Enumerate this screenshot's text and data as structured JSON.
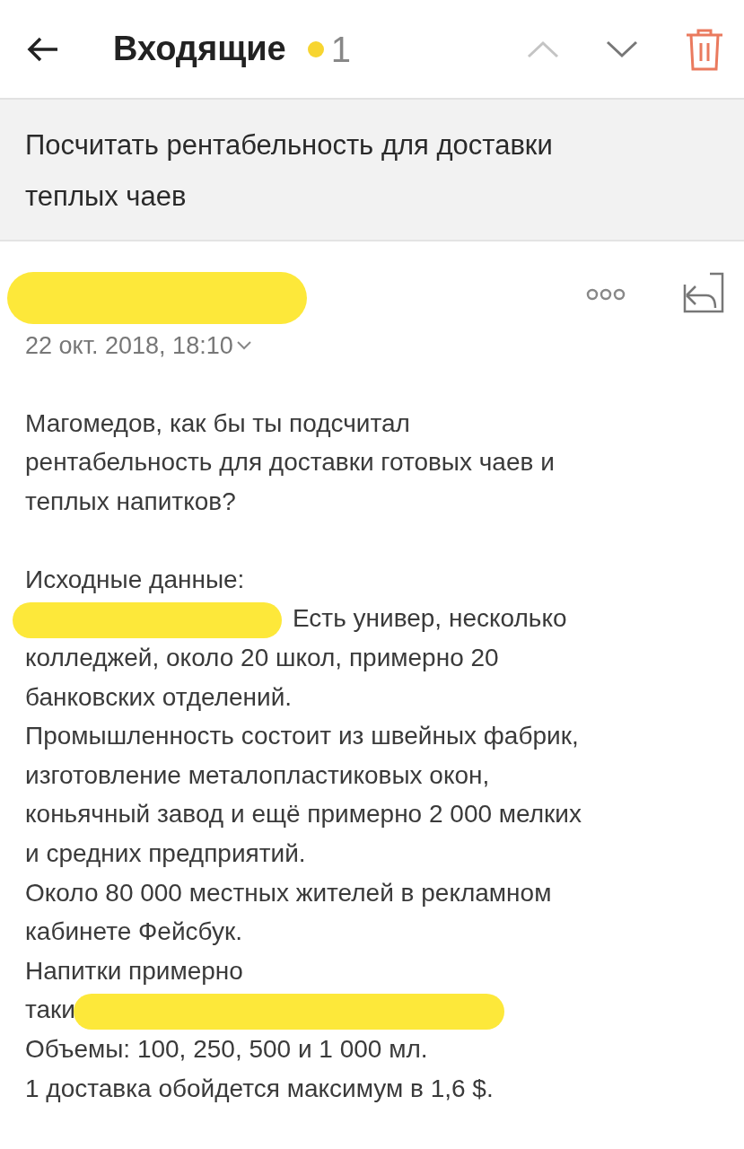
{
  "header": {
    "title": "Входящие",
    "unread_count": "1"
  },
  "subject": "Посчитать рентабельность для доставки теплых чаев",
  "message": {
    "sender_redacted": true,
    "date": "22 окт. 2018, 18:10",
    "body": [
      {
        "kind": "text",
        "text": "Магомедов, как бы ты подсчитал"
      },
      {
        "kind": "text",
        "text": "рентабельность для доставки готовых чаев и"
      },
      {
        "kind": "text",
        "text": "теплых напитков?"
      },
      {
        "kind": "blank"
      },
      {
        "kind": "text",
        "text": "Исходные данные:"
      },
      {
        "kind": "redacted",
        "after": "Есть универ, несколько"
      },
      {
        "kind": "text",
        "text": "колледжей, около 20 школ, примерно 20"
      },
      {
        "kind": "text",
        "text": "банковских отделений."
      },
      {
        "kind": "text",
        "text": "Промышленность состоит из швейных фабрик,"
      },
      {
        "kind": "text",
        "text": "изготовление металопластиковых окон,"
      },
      {
        "kind": "text",
        "text": "коньячный завод и ещё примерно 2 000 мелких"
      },
      {
        "kind": "text",
        "text": "и средних предприятий."
      },
      {
        "kind": "text",
        "text": "Около 80 000 местных жителей в рекламном"
      },
      {
        "kind": "text",
        "text": "кабинете Фейсбук."
      },
      {
        "kind": "text",
        "text": "Напитки примерно"
      },
      {
        "kind": "redacted",
        "before": "таки"
      },
      {
        "kind": "text",
        "text": "Объемы: 100, 250, 500 и 1 000 мл."
      },
      {
        "kind": "text",
        "text": "1 доставка обойдется максимум в 1,6 $."
      }
    ]
  }
}
